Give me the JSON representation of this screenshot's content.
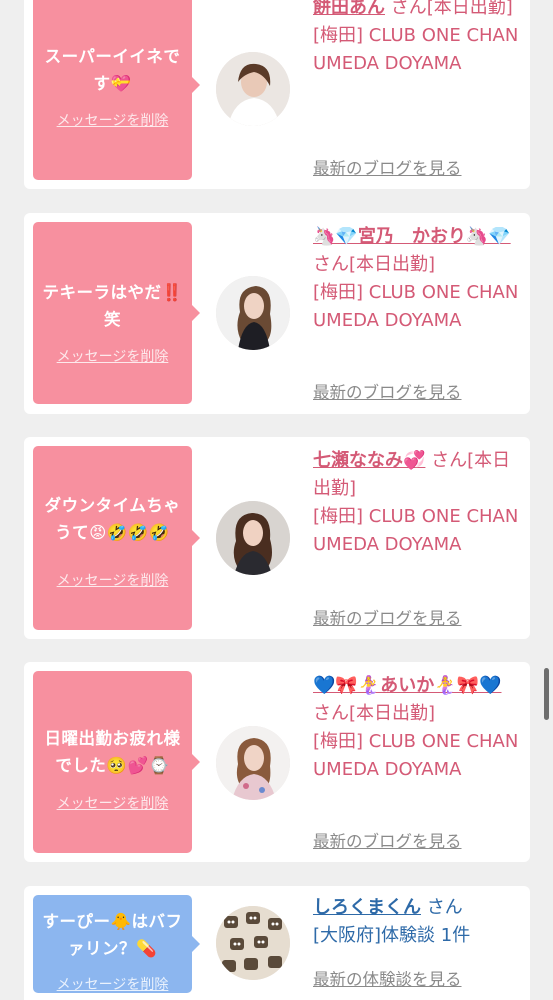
{
  "items": [
    {
      "message": "スーパーイイネです💝",
      "delete_label": "メッセージを削除",
      "name": "餅田あん",
      "suffix": "さん[本日出勤]",
      "shop": "[梅田] CLUB ONE CHAN UMEDA DOYAMA",
      "link": "最新のブログを見る",
      "bubble_color": "#f7909f"
    },
    {
      "message": "テキーラはやだ‼️笑",
      "delete_label": "メッセージを削除",
      "name": "🦄💎宮乃　かおり🦄💎",
      "suffix": "さん[本日出勤]",
      "shop": "[梅田] CLUB ONE CHAN UMEDA DOYAMA",
      "link": "最新のブログを見る",
      "bubble_color": "#f7909f"
    },
    {
      "message": "ダウンタイムちゃうて😡🤣🤣🤣",
      "delete_label": "メッセージを削除",
      "name": "七瀬ななみ💞",
      "suffix": "さん[本日出勤]",
      "shop": "[梅田] CLUB ONE CHAN UMEDA DOYAMA",
      "link": "最新のブログを見る",
      "bubble_color": "#f7909f"
    },
    {
      "message": "日曜出勤お疲れ様でした🥺💕⌚",
      "delete_label": "メッセージを削除",
      "name": "💙🎀🧜‍♀️あいか🧜‍♀️🎀💙",
      "suffix": "さん[本日出勤]",
      "shop": "[梅田] CLUB ONE CHAN UMEDA DOYAMA",
      "link": "最新のブログを見る",
      "bubble_color": "#f7909f"
    },
    {
      "message": "すーぴー🐥はバファリン？💊",
      "delete_label": "メッセージを削除",
      "name": "しろくまくん",
      "suffix": "さん",
      "shop": "[大阪府]体験談 1件",
      "link": "最新の体験談を見る",
      "bubble_color": "#8cb6ef"
    }
  ]
}
